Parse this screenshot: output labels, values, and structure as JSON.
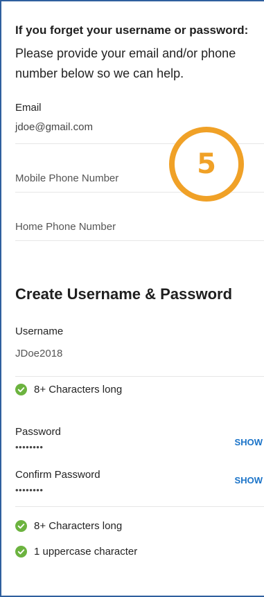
{
  "intro": {
    "title": "If you forget your username or password:",
    "text": "Please provide your email and/or phone number below so we can help."
  },
  "contact": {
    "email_label": "Email",
    "email_value": "jdoe@gmail.com",
    "mobile_label": "Mobile Phone Number",
    "home_label": "Home Phone Number"
  },
  "credentials": {
    "section_title": "Create Username & Password",
    "username_label": "Username",
    "username_value": "JDoe2018",
    "username_rule": "8+ Characters long",
    "password_label": "Password",
    "password_value": "••••••••",
    "show_label": "SHOW",
    "confirm_label": "Confirm Password",
    "confirm_value": "••••••••",
    "password_rules": [
      "8+ Characters long",
      "1 uppercase character"
    ]
  },
  "badge": {
    "number": "5"
  },
  "colors": {
    "accent": "#1a73c8",
    "check_green": "#6cb33f",
    "badge_orange": "#f0a127",
    "frame_border": "#2f5f9e"
  },
  "icons": {
    "rule_met": "check-circle-icon"
  }
}
